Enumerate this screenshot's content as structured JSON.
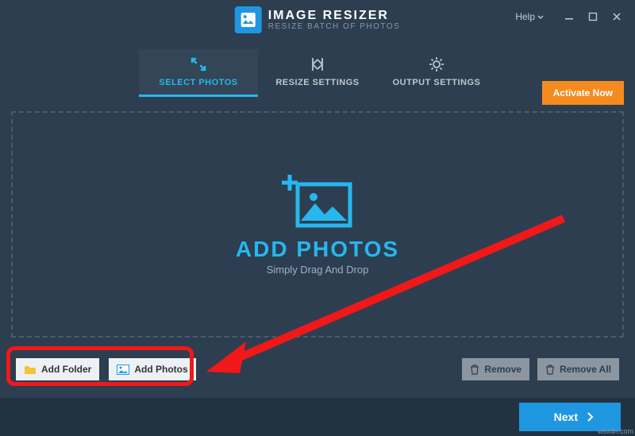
{
  "app": {
    "title": "IMAGE RESIZER",
    "subtitle": "RESIZE BATCH OF PHOTOS"
  },
  "titlebar": {
    "help": "Help"
  },
  "tabs": {
    "select": "SELECT PHOTOS",
    "resize": "RESIZE SETTINGS",
    "output": "OUTPUT SETTINGS"
  },
  "activate": "Activate Now",
  "drop": {
    "title": "ADD PHOTOS",
    "sub": "Simply Drag And Drop"
  },
  "buttons": {
    "addFolder": "Add Folder",
    "addPhotos": "Add Photos",
    "remove": "Remove",
    "removeAll": "Remove All",
    "next": "Next"
  },
  "watermark": "wsxdn.com"
}
